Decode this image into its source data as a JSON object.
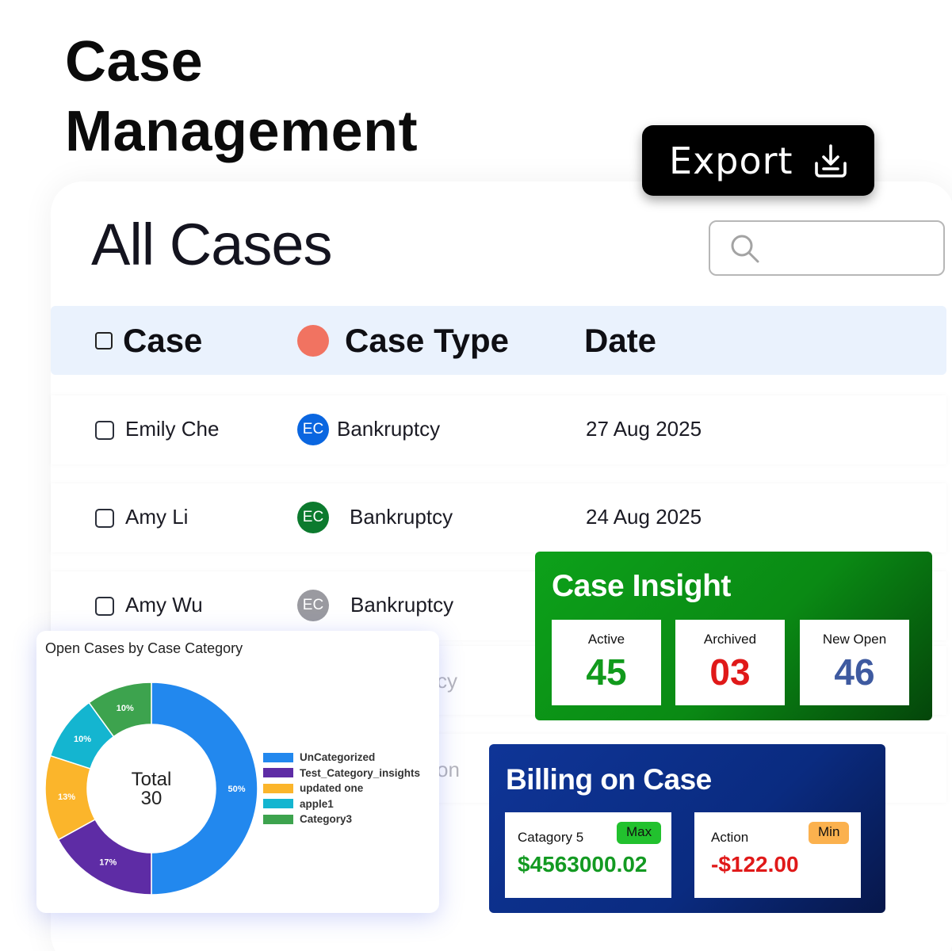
{
  "hero": {
    "line1": "Case",
    "line2": "Management"
  },
  "export": {
    "label": "Export",
    "icon": "download-tray-icon"
  },
  "panel": {
    "title": "All Cases"
  },
  "search": {
    "icon": "search-icon",
    "value": ""
  },
  "table": {
    "headers": {
      "case": "Case",
      "case_type": "Case Type",
      "date": "Date"
    },
    "rows": [
      {
        "name": "Emily Che",
        "avatar": "EC",
        "avatar_color": "#0a66e0",
        "type": "Bankruptcy",
        "date": "27 Aug 2025"
      },
      {
        "name": "Amy Li",
        "avatar": "EC",
        "avatar_color": "#0c7a2e",
        "type": "Bankruptcy",
        "date": "24 Aug 2025"
      },
      {
        "name": "Amy Wu",
        "avatar": "EC",
        "avatar_color": "#9a9aa0",
        "type": "Bankruptcy",
        "date": ""
      },
      {
        "name": "",
        "avatar": "",
        "type": "cy",
        "date": ""
      },
      {
        "name": "",
        "avatar": "",
        "type": "on",
        "date": ""
      }
    ]
  },
  "donut": {
    "title": "Open Cases by Case Category",
    "center_label": "Total",
    "center_value": "30"
  },
  "chart_data": {
    "type": "pie",
    "title": "Open Cases by Case Category",
    "categories": [
      "UnCategorized",
      "Test_Category_insights",
      "updated one",
      "apple1",
      "Category3"
    ],
    "values": [
      50,
      17,
      13,
      10,
      10
    ],
    "labels": [
      "50%",
      "17%",
      "13%",
      "10%",
      "10%"
    ],
    "colors": [
      "#2288ee",
      "#5e2ca5",
      "#fbb52b",
      "#14b5d0",
      "#3da34e"
    ],
    "legend_position": "right"
  },
  "insight": {
    "title": "Case Insight",
    "stats": [
      {
        "label": "Active",
        "value": "45",
        "color": "#119a1c"
      },
      {
        "label": "Archived",
        "value": "03",
        "color": "#e01919"
      },
      {
        "label": "New Open",
        "value": "46",
        "color": "#3e5aa0"
      }
    ]
  },
  "billing": {
    "title": "Billing on Case",
    "items": [
      {
        "label": "Catagory 5",
        "badge": "Max",
        "badge_color": "#22c12e",
        "value": "$4563000.02",
        "value_color": "#139a22"
      },
      {
        "label": "Action",
        "badge": "Min",
        "badge_color": "#fbb14e",
        "value": "-$122.00",
        "value_color": "#e01919"
      }
    ]
  }
}
